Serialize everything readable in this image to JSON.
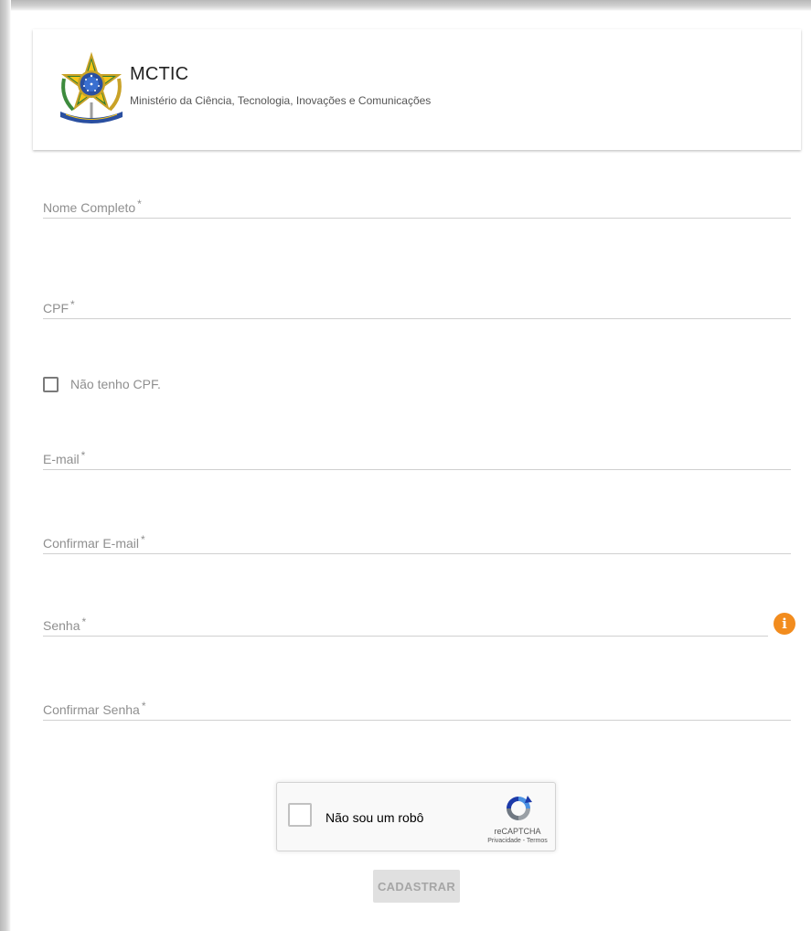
{
  "header": {
    "org_name": "MCTIC",
    "org_full_name": "Ministério da Ciência, Tecnologia, Inovações e Comunicações",
    "logo_icon": "brazil-coat-of-arms-icon"
  },
  "form": {
    "fields": [
      {
        "label": "Nome Completo",
        "required": "*"
      },
      {
        "label": "CPF",
        "required": "*"
      },
      {
        "label": "E-mail",
        "required": "*"
      },
      {
        "label": "Confirmar E-mail",
        "required": "*"
      },
      {
        "label": "Senha",
        "required": "*"
      },
      {
        "label": "Confirmar Senha",
        "required": "*"
      }
    ],
    "no_cpf_label": "Não tenho CPF.",
    "password_info_icon": "info-icon",
    "info_icon_color": "#f28c1e",
    "submit_label": "CADASTRAR"
  },
  "recaptcha": {
    "label": "Não sou um robô",
    "brand": "reCAPTCHA",
    "terms": "Privacidade - Termos"
  }
}
